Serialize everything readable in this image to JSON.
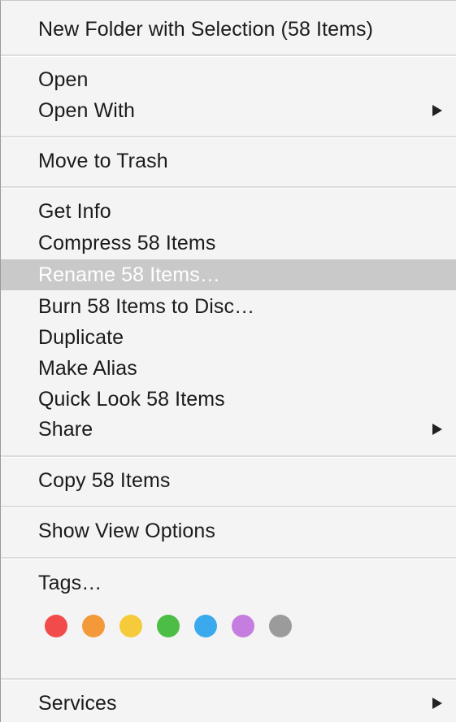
{
  "menu": {
    "new_folder": "New Folder with Selection (58 Items)",
    "open": "Open",
    "open_with": "Open With",
    "move_to_trash": "Move to Trash",
    "get_info": "Get Info",
    "compress": "Compress 58 Items",
    "rename": "Rename 58 Items…",
    "burn": "Burn 58 Items to Disc…",
    "duplicate": "Duplicate",
    "make_alias": "Make Alias",
    "quick_look": "Quick Look 58 Items",
    "share": "Share",
    "copy": "Copy 58 Items",
    "show_view_options": "Show View Options",
    "tags": "Tags…",
    "services": "Services",
    "submenu_icon": "triangle-right-icon",
    "highlight_color": "#c9c9c9"
  },
  "tag_colors": [
    {
      "name": "red",
      "color": "#f24b4b"
    },
    {
      "name": "orange",
      "color": "#f4993a"
    },
    {
      "name": "yellow",
      "color": "#f5cb3b"
    },
    {
      "name": "green",
      "color": "#4cbe46"
    },
    {
      "name": "blue",
      "color": "#3ba9ee"
    },
    {
      "name": "purple",
      "color": "#c57ee0"
    },
    {
      "name": "gray",
      "color": "#9b9b9b"
    }
  ]
}
